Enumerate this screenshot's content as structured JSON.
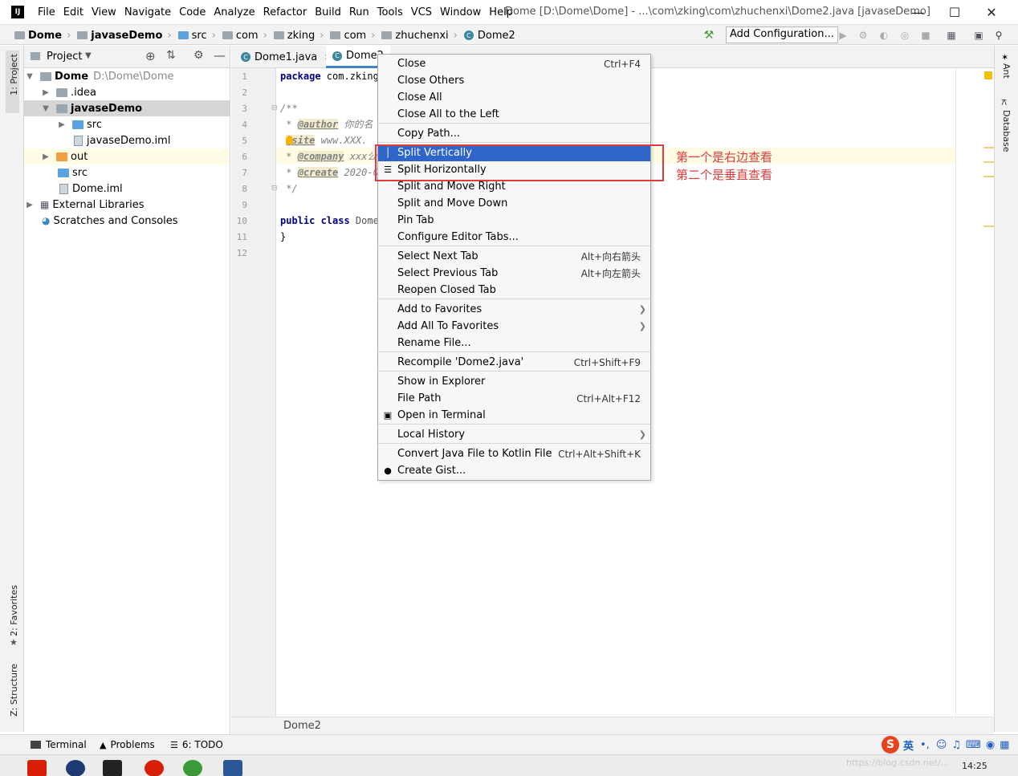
{
  "window": {
    "title": "Dome [D:\\Dome\\Dome] - ...\\com\\zking\\com\\zhuchenxi\\Dome2.java [javaseDemo]",
    "menu": [
      "File",
      "Edit",
      "View",
      "Navigate",
      "Code",
      "Analyze",
      "Refactor",
      "Build",
      "Run",
      "Tools",
      "VCS",
      "Window",
      "Help"
    ]
  },
  "breadcrumbs": [
    "Dome",
    "javaseDemo",
    "src",
    "com",
    "zking",
    "com",
    "zhuchenxi",
    "Dome2"
  ],
  "toolbar": {
    "add_config_label": "Add Configuration..."
  },
  "left_strip": {
    "project_label": "1: Project",
    "favorites_label": "2: Favorites",
    "structure_label": "Z: Structure"
  },
  "right_strip": {
    "ant_label": "Ant",
    "database_label": "Database"
  },
  "project_panel": {
    "title": "Project",
    "tree": [
      {
        "label": "Dome",
        "extra": "D:\\Dome\\Dome",
        "bold": true
      },
      {
        "label": ".idea"
      },
      {
        "label": "javaseDemo",
        "bold": true
      },
      {
        "label": "src"
      },
      {
        "label": "javaseDemo.iml"
      },
      {
        "label": "out"
      },
      {
        "label": "src"
      },
      {
        "label": "Dome.iml"
      },
      {
        "label": "External Libraries"
      },
      {
        "label": "Scratches and Consoles"
      }
    ]
  },
  "editor": {
    "tabs": [
      "Dome1.java",
      "Dome2"
    ],
    "line_numbers": [
      "1",
      "2",
      "3",
      "4",
      "5",
      "6",
      "7",
      "8",
      "9",
      "10",
      "11",
      "12"
    ],
    "lines": {
      "l1_kw": "package",
      "l1_rest": " com.zking",
      "l3": "/**",
      "l4_star": " * ",
      "l4_tag": "@author",
      "l4_rest": " 你的名",
      "l5_star": " ",
      "l5_tag": "@site",
      "l5_rest": " www.XXX.",
      "l6_star": " * ",
      "l6_tag": "@company",
      "l6_rest": " xxx公",
      "l7_star": " * ",
      "l7_tag": "@create",
      "l7_rest": " 2020-0",
      "l8": " */",
      "l10_kw": "public class",
      "l10_rest": " Dome",
      "l11": "}"
    },
    "footer_crumb": "Dome2"
  },
  "context_menu": {
    "items": [
      {
        "label": "Close",
        "shortcut": "Ctrl+F4"
      },
      {
        "label": "Close Others"
      },
      {
        "label": "Close All"
      },
      {
        "label": "Close All to the Left"
      },
      {
        "label": "Copy Path..."
      },
      {
        "label": "Split Vertically",
        "selected": true
      },
      {
        "label": "Split Horizontally"
      },
      {
        "label": "Split and Move Right"
      },
      {
        "label": "Split and Move Down"
      },
      {
        "label": "Pin Tab"
      },
      {
        "label": "Configure Editor Tabs..."
      },
      {
        "label": "Select Next Tab",
        "shortcut": "Alt+向右箭头"
      },
      {
        "label": "Select Previous Tab",
        "shortcut": "Alt+向左箭头"
      },
      {
        "label": "Reopen Closed Tab"
      },
      {
        "label": "Add to Favorites",
        "submenu": true
      },
      {
        "label": "Add All To Favorites",
        "submenu": true
      },
      {
        "label": "Rename File..."
      },
      {
        "label": "Recompile 'Dome2.java'",
        "shortcut": "Ctrl+Shift+F9"
      },
      {
        "label": "Show in Explorer"
      },
      {
        "label": "File Path",
        "shortcut": "Ctrl+Alt+F12"
      },
      {
        "label": "Open in Terminal"
      },
      {
        "label": "Local History",
        "submenu": true
      },
      {
        "label": "Convert Java File to Kotlin File",
        "shortcut": "Ctrl+Alt+Shift+K"
      },
      {
        "label": "Create Gist..."
      }
    ],
    "selected_color": "#2f65ca"
  },
  "annotations": {
    "line1": "第一个是右边查看",
    "line2": "第二个是垂直查看",
    "color": "#e23b3b"
  },
  "bottom_tools": [
    "Terminal",
    "Problems",
    "6: TODO"
  ],
  "taskbar": {
    "ime_label": "英",
    "clock": "14:25",
    "watermark": "https://blog.csdn.net/..."
  }
}
